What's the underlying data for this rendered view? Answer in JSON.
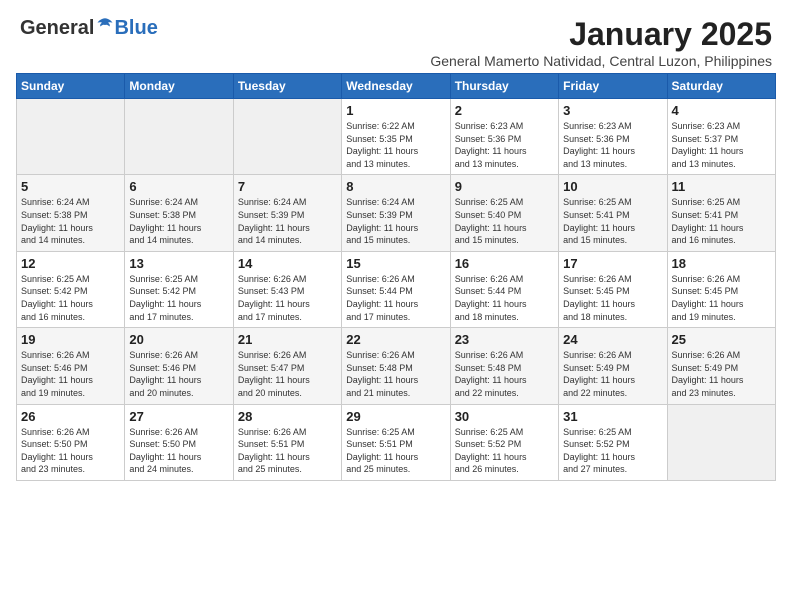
{
  "header": {
    "logo": {
      "general": "General",
      "blue": "Blue"
    },
    "title": "January 2025",
    "location": "General Mamerto Natividad, Central Luzon, Philippines"
  },
  "weekdays": [
    "Sunday",
    "Monday",
    "Tuesday",
    "Wednesday",
    "Thursday",
    "Friday",
    "Saturday"
  ],
  "weeks": [
    [
      {
        "day": "",
        "info": ""
      },
      {
        "day": "",
        "info": ""
      },
      {
        "day": "",
        "info": ""
      },
      {
        "day": "1",
        "info": "Sunrise: 6:22 AM\nSunset: 5:35 PM\nDaylight: 11 hours\nand 13 minutes."
      },
      {
        "day": "2",
        "info": "Sunrise: 6:23 AM\nSunset: 5:36 PM\nDaylight: 11 hours\nand 13 minutes."
      },
      {
        "day": "3",
        "info": "Sunrise: 6:23 AM\nSunset: 5:36 PM\nDaylight: 11 hours\nand 13 minutes."
      },
      {
        "day": "4",
        "info": "Sunrise: 6:23 AM\nSunset: 5:37 PM\nDaylight: 11 hours\nand 13 minutes."
      }
    ],
    [
      {
        "day": "5",
        "info": "Sunrise: 6:24 AM\nSunset: 5:38 PM\nDaylight: 11 hours\nand 14 minutes."
      },
      {
        "day": "6",
        "info": "Sunrise: 6:24 AM\nSunset: 5:38 PM\nDaylight: 11 hours\nand 14 minutes."
      },
      {
        "day": "7",
        "info": "Sunrise: 6:24 AM\nSunset: 5:39 PM\nDaylight: 11 hours\nand 14 minutes."
      },
      {
        "day": "8",
        "info": "Sunrise: 6:24 AM\nSunset: 5:39 PM\nDaylight: 11 hours\nand 15 minutes."
      },
      {
        "day": "9",
        "info": "Sunrise: 6:25 AM\nSunset: 5:40 PM\nDaylight: 11 hours\nand 15 minutes."
      },
      {
        "day": "10",
        "info": "Sunrise: 6:25 AM\nSunset: 5:41 PM\nDaylight: 11 hours\nand 15 minutes."
      },
      {
        "day": "11",
        "info": "Sunrise: 6:25 AM\nSunset: 5:41 PM\nDaylight: 11 hours\nand 16 minutes."
      }
    ],
    [
      {
        "day": "12",
        "info": "Sunrise: 6:25 AM\nSunset: 5:42 PM\nDaylight: 11 hours\nand 16 minutes."
      },
      {
        "day": "13",
        "info": "Sunrise: 6:25 AM\nSunset: 5:42 PM\nDaylight: 11 hours\nand 17 minutes."
      },
      {
        "day": "14",
        "info": "Sunrise: 6:26 AM\nSunset: 5:43 PM\nDaylight: 11 hours\nand 17 minutes."
      },
      {
        "day": "15",
        "info": "Sunrise: 6:26 AM\nSunset: 5:44 PM\nDaylight: 11 hours\nand 17 minutes."
      },
      {
        "day": "16",
        "info": "Sunrise: 6:26 AM\nSunset: 5:44 PM\nDaylight: 11 hours\nand 18 minutes."
      },
      {
        "day": "17",
        "info": "Sunrise: 6:26 AM\nSunset: 5:45 PM\nDaylight: 11 hours\nand 18 minutes."
      },
      {
        "day": "18",
        "info": "Sunrise: 6:26 AM\nSunset: 5:45 PM\nDaylight: 11 hours\nand 19 minutes."
      }
    ],
    [
      {
        "day": "19",
        "info": "Sunrise: 6:26 AM\nSunset: 5:46 PM\nDaylight: 11 hours\nand 19 minutes."
      },
      {
        "day": "20",
        "info": "Sunrise: 6:26 AM\nSunset: 5:46 PM\nDaylight: 11 hours\nand 20 minutes."
      },
      {
        "day": "21",
        "info": "Sunrise: 6:26 AM\nSunset: 5:47 PM\nDaylight: 11 hours\nand 20 minutes."
      },
      {
        "day": "22",
        "info": "Sunrise: 6:26 AM\nSunset: 5:48 PM\nDaylight: 11 hours\nand 21 minutes."
      },
      {
        "day": "23",
        "info": "Sunrise: 6:26 AM\nSunset: 5:48 PM\nDaylight: 11 hours\nand 22 minutes."
      },
      {
        "day": "24",
        "info": "Sunrise: 6:26 AM\nSunset: 5:49 PM\nDaylight: 11 hours\nand 22 minutes."
      },
      {
        "day": "25",
        "info": "Sunrise: 6:26 AM\nSunset: 5:49 PM\nDaylight: 11 hours\nand 23 minutes."
      }
    ],
    [
      {
        "day": "26",
        "info": "Sunrise: 6:26 AM\nSunset: 5:50 PM\nDaylight: 11 hours\nand 23 minutes."
      },
      {
        "day": "27",
        "info": "Sunrise: 6:26 AM\nSunset: 5:50 PM\nDaylight: 11 hours\nand 24 minutes."
      },
      {
        "day": "28",
        "info": "Sunrise: 6:26 AM\nSunset: 5:51 PM\nDaylight: 11 hours\nand 25 minutes."
      },
      {
        "day": "29",
        "info": "Sunrise: 6:25 AM\nSunset: 5:51 PM\nDaylight: 11 hours\nand 25 minutes."
      },
      {
        "day": "30",
        "info": "Sunrise: 6:25 AM\nSunset: 5:52 PM\nDaylight: 11 hours\nand 26 minutes."
      },
      {
        "day": "31",
        "info": "Sunrise: 6:25 AM\nSunset: 5:52 PM\nDaylight: 11 hours\nand 27 minutes."
      },
      {
        "day": "",
        "info": ""
      }
    ]
  ]
}
